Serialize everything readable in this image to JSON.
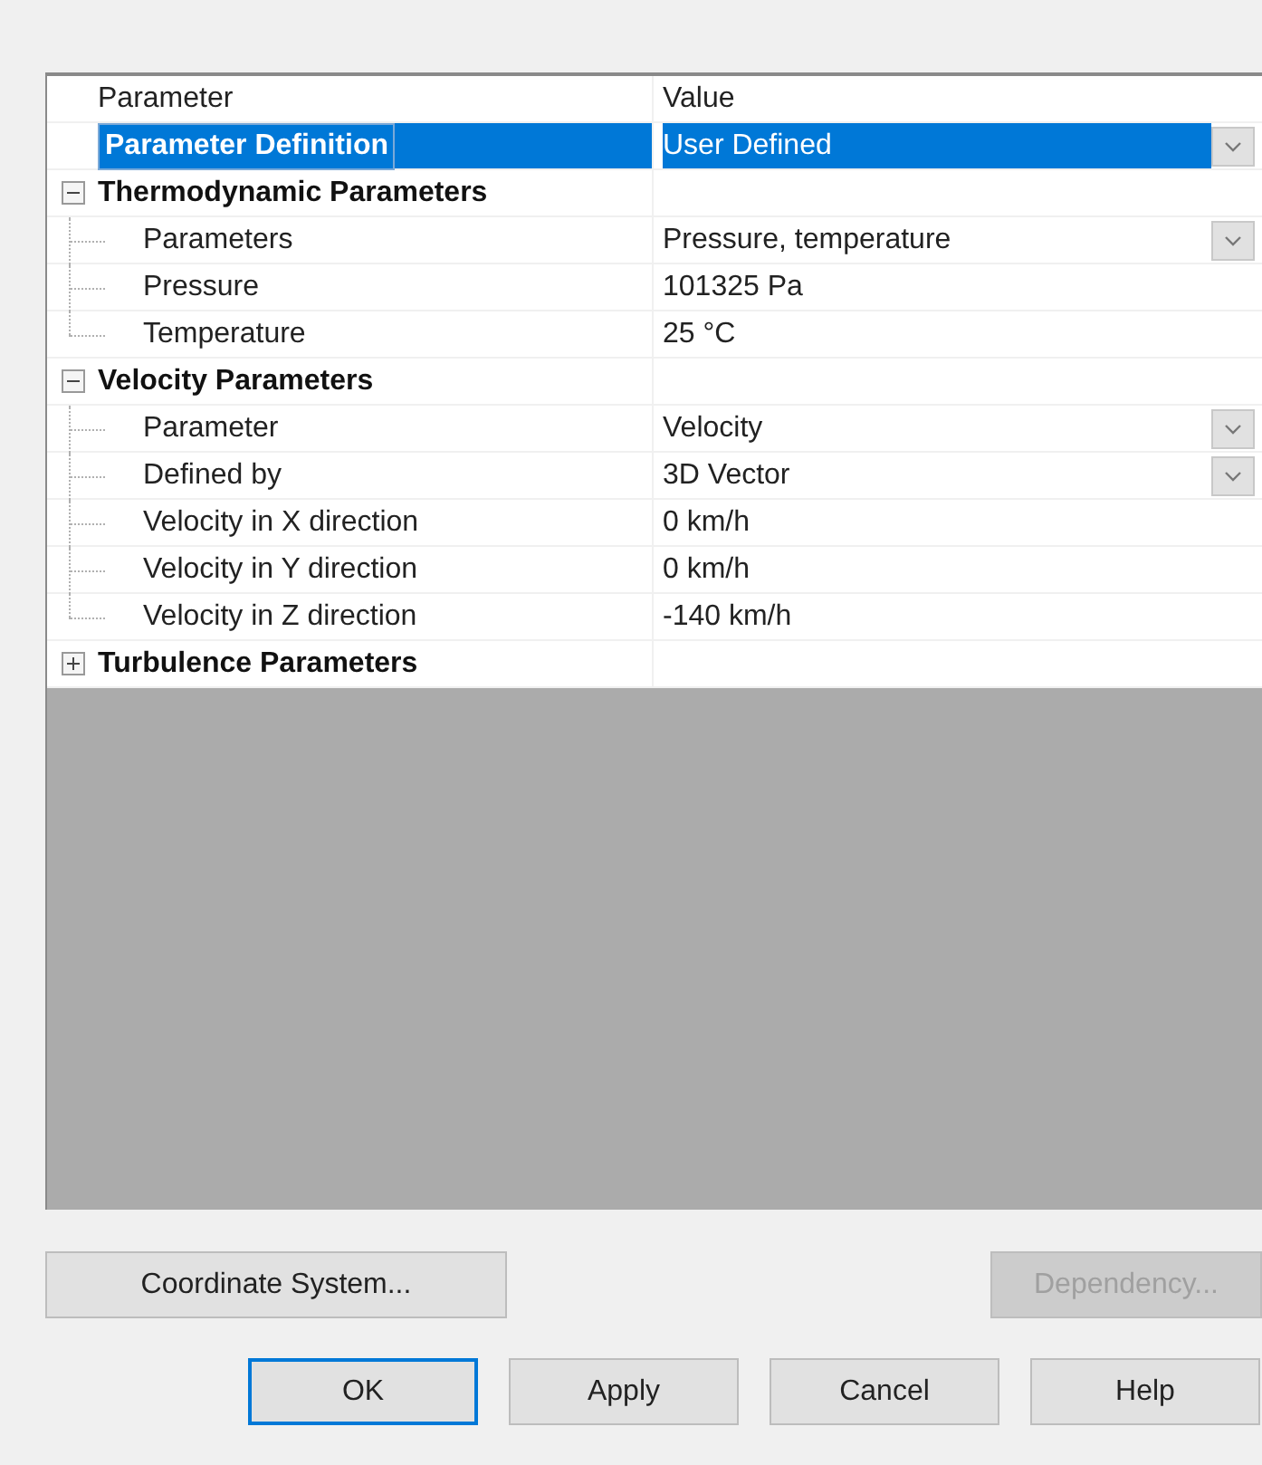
{
  "grid": {
    "columns": [
      "Parameter",
      "Value"
    ],
    "rows": [
      {
        "kind": "property",
        "name": "Parameter Definition",
        "value": "User Defined",
        "dropdown": true,
        "selected": true,
        "bold": true
      },
      {
        "kind": "group",
        "name": "Thermodynamic Parameters",
        "expanded": true,
        "children": [
          {
            "kind": "property",
            "name": "Parameters",
            "value": "Pressure, temperature",
            "dropdown": true,
            "selected": false
          },
          {
            "kind": "property",
            "name": "Pressure",
            "value": "101325 Pa",
            "dropdown": false,
            "selected": false
          },
          {
            "kind": "property",
            "name": "Temperature",
            "value": "25 °C",
            "dropdown": false,
            "selected": false
          }
        ]
      },
      {
        "kind": "group",
        "name": "Velocity Parameters",
        "expanded": true,
        "children": [
          {
            "kind": "property",
            "name": "Parameter",
            "value": "Velocity",
            "dropdown": true,
            "selected": false
          },
          {
            "kind": "property",
            "name": "Defined by",
            "value": "3D Vector",
            "dropdown": true,
            "selected": false
          },
          {
            "kind": "property",
            "name": "Velocity in X direction",
            "value": "0 km/h",
            "dropdown": false,
            "selected": false
          },
          {
            "kind": "property",
            "name": "Velocity in Y direction",
            "value": "0 km/h",
            "dropdown": false,
            "selected": false
          },
          {
            "kind": "property",
            "name": "Velocity in Z direction",
            "value": "-140 km/h",
            "dropdown": false,
            "selected": false
          }
        ]
      },
      {
        "kind": "group",
        "name": "Turbulence Parameters",
        "expanded": false
      }
    ]
  },
  "side_buttons": [
    {
      "label": "Coordinate System...",
      "disabled": false
    },
    {
      "label": "Dependency...",
      "disabled": true
    }
  ],
  "buttons": [
    {
      "label": "OK",
      "default": true
    },
    {
      "label": "Apply",
      "default": false
    },
    {
      "label": "Cancel",
      "default": false
    },
    {
      "label": "Help",
      "default": false
    }
  ]
}
